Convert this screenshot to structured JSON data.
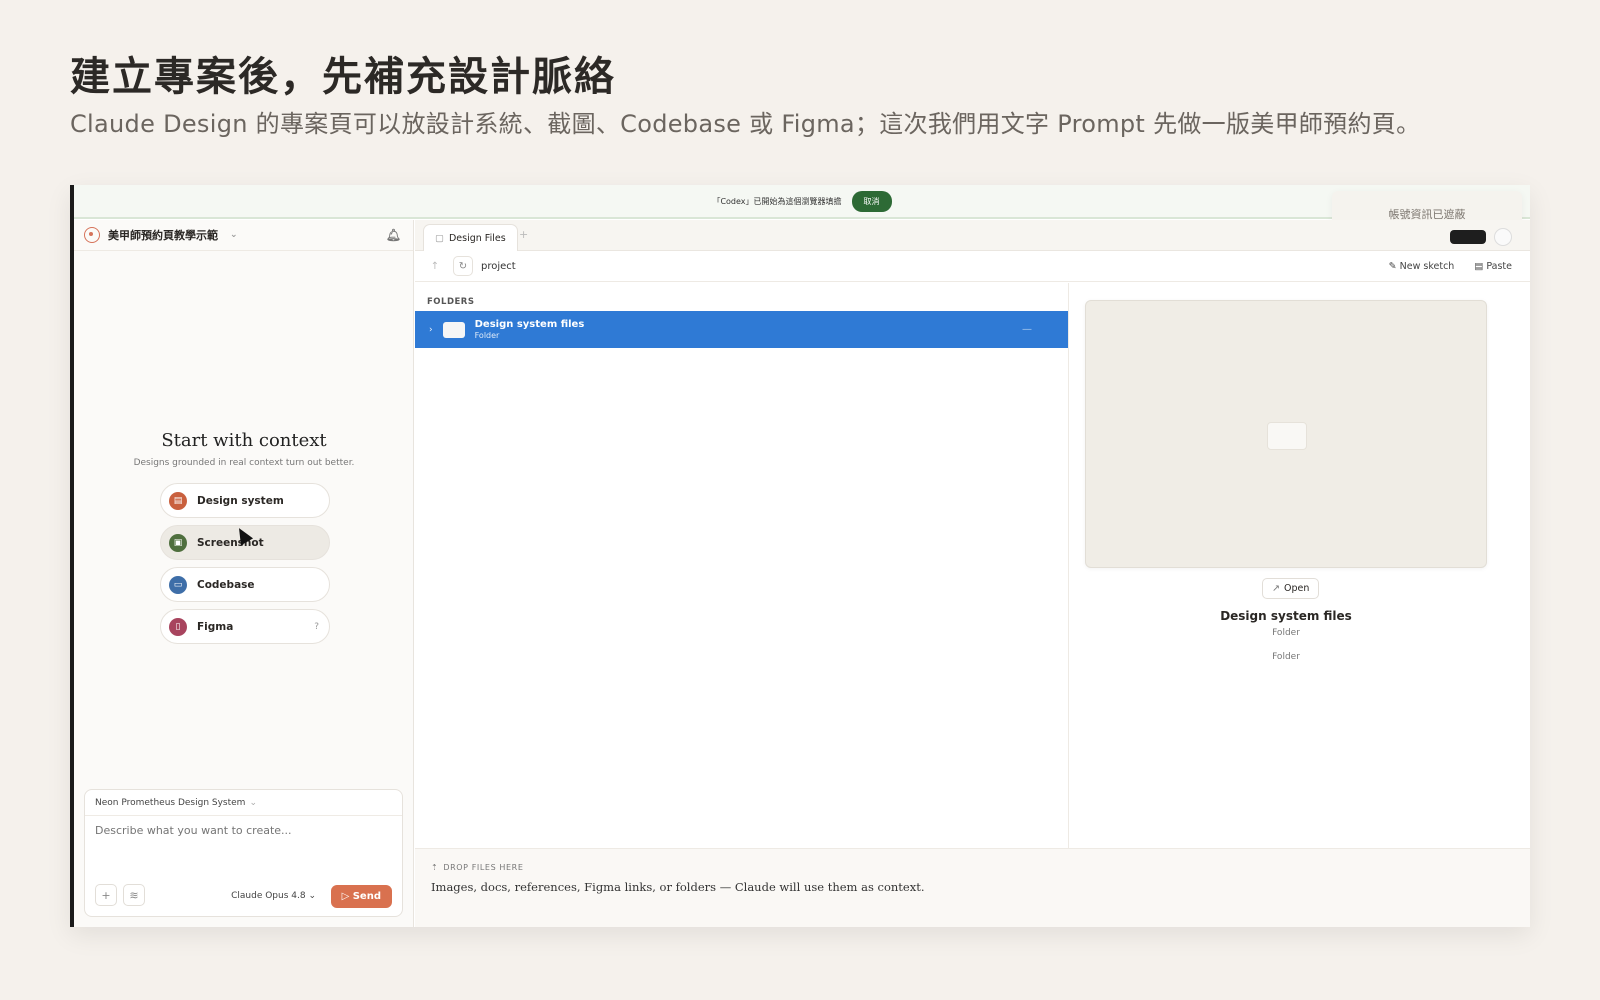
{
  "hero": {
    "title": "建立專案後，先補充設計脈絡",
    "subtitle": "Claude Design 的專案頁可以放設計系統、截圖、Codebase 或 Figma；這次我們用文字 Prompt 先做一版美甲師預約頁。"
  },
  "banner": {
    "message": "「Codex」已開始為這個瀏覽器填擔",
    "cancel_label": "取消"
  },
  "toast": {
    "text": "帳號資訊已遮蔽"
  },
  "project": {
    "name": "美甲師預約頁教學示範"
  },
  "context": {
    "title": "Start with context",
    "subtitle": "Designs grounded in real context turn out better.",
    "items": [
      {
        "label": "Design system",
        "icon": "design-system-icon",
        "color": "#c9603e"
      },
      {
        "label": "Screenshot",
        "icon": "screenshot-icon",
        "color": "#4f6f3e"
      },
      {
        "label": "Codebase",
        "icon": "codebase-icon",
        "color": "#3e6ea8"
      },
      {
        "label": "Figma",
        "icon": "figma-icon",
        "color": "#a8445e"
      }
    ]
  },
  "composer": {
    "design_system": "Neon Prometheus Design System",
    "placeholder": "Describe what you want to create...",
    "model": "Claude Opus 4.8",
    "send_label": "Send"
  },
  "tabs": [
    {
      "label": "Design Files"
    }
  ],
  "pathbar": {
    "path": "project",
    "new_sketch_label": "New sketch",
    "paste_label": "Paste"
  },
  "files": {
    "section_label": "FOLDERS",
    "rows": [
      {
        "name": "Design system files",
        "type": "Folder"
      }
    ]
  },
  "preview": {
    "open_label": "Open",
    "name": "Design system files",
    "type": "Folder",
    "kind": "Folder"
  },
  "drop": {
    "label": "DROP FILES HERE",
    "text": "Images, docs, references, Figma links, or folders — Claude will use them as context."
  },
  "colors": {
    "accent": "#2f7ad5",
    "send": "#d9714f",
    "banner_button": "#2d6a35"
  }
}
